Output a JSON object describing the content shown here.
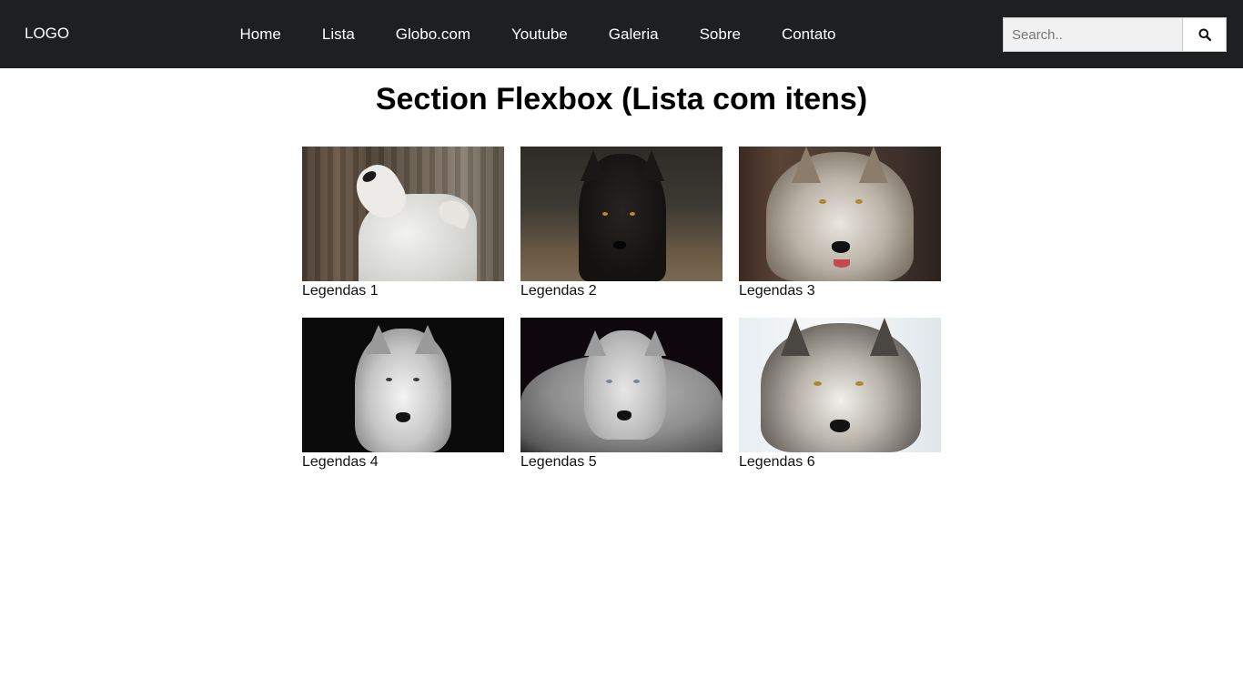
{
  "navbar": {
    "logo": "LOGO",
    "links": [
      "Home",
      "Lista",
      "Globo.com",
      "Youtube",
      "Galeria",
      "Sobre",
      "Contato"
    ],
    "search_placeholder": "Search..",
    "search_icon": "search-icon"
  },
  "page_title": "Section Flexbox (Lista com itens)",
  "gallery": {
    "items": [
      {
        "caption": "Legendas 1",
        "image": "white-wolf-howling"
      },
      {
        "caption": "Legendas 2",
        "image": "black-wolf"
      },
      {
        "caption": "Legendas 3",
        "image": "gray-wolf-snarling"
      },
      {
        "caption": "Legendas 4",
        "image": "white-wolf-dark-background"
      },
      {
        "caption": "Legendas 5",
        "image": "gray-white-wolf-dark-background"
      },
      {
        "caption": "Legendas 6",
        "image": "gray-wolf-snow"
      }
    ]
  },
  "colors": {
    "navbar_bg": "#1e1f21",
    "nav_text": "#ffffff",
    "search_bg": "#f1f1f1"
  }
}
